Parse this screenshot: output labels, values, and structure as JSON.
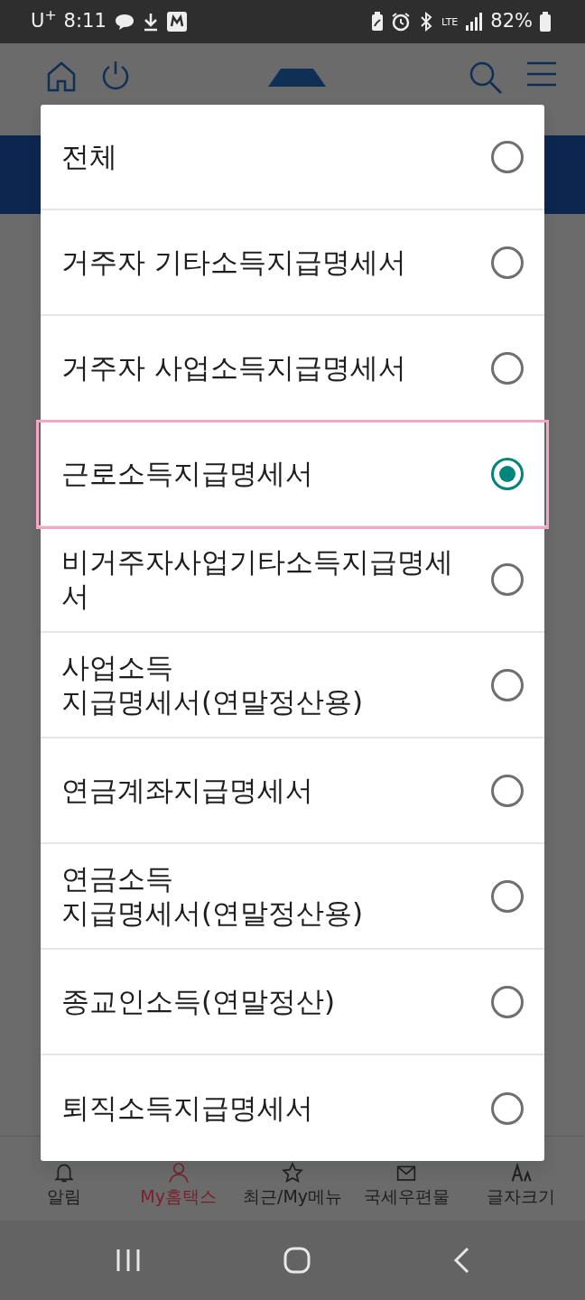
{
  "status_bar": {
    "carrier": "U$^{+}$",
    "time": "8:11",
    "network": "LTE",
    "battery": "82%"
  },
  "dialog": {
    "options": [
      {
        "label": "전체",
        "selected": false
      },
      {
        "label": "거주자 기타소득지급명세서",
        "selected": false
      },
      {
        "label": "거주자 사업소득지급명세서",
        "selected": false
      },
      {
        "label": "근로소득지급명세서",
        "selected": true
      },
      {
        "label": "비거주자사업기타소득지급명세서",
        "selected": false
      },
      {
        "label": "사업소득\n지급명세서(연말정산용)",
        "selected": false
      },
      {
        "label": "연금계좌지급명세서",
        "selected": false
      },
      {
        "label": "연금소득\n지급명세서(연말정산용)",
        "selected": false
      },
      {
        "label": "종교인소득(연말정산)",
        "selected": false
      },
      {
        "label": "퇴직소득지급명세서",
        "selected": false
      }
    ]
  },
  "bottom_nav": [
    {
      "label": "알림",
      "kind": "bell",
      "selected": false
    },
    {
      "label": "My홈택스",
      "kind": "person",
      "selected": true
    },
    {
      "label": "최근/My메뉴",
      "kind": "star",
      "selected": false
    },
    {
      "label": "국세우편물",
      "kind": "mail",
      "selected": false
    },
    {
      "label": "글자크기",
      "kind": "fontsize",
      "selected": false
    }
  ]
}
